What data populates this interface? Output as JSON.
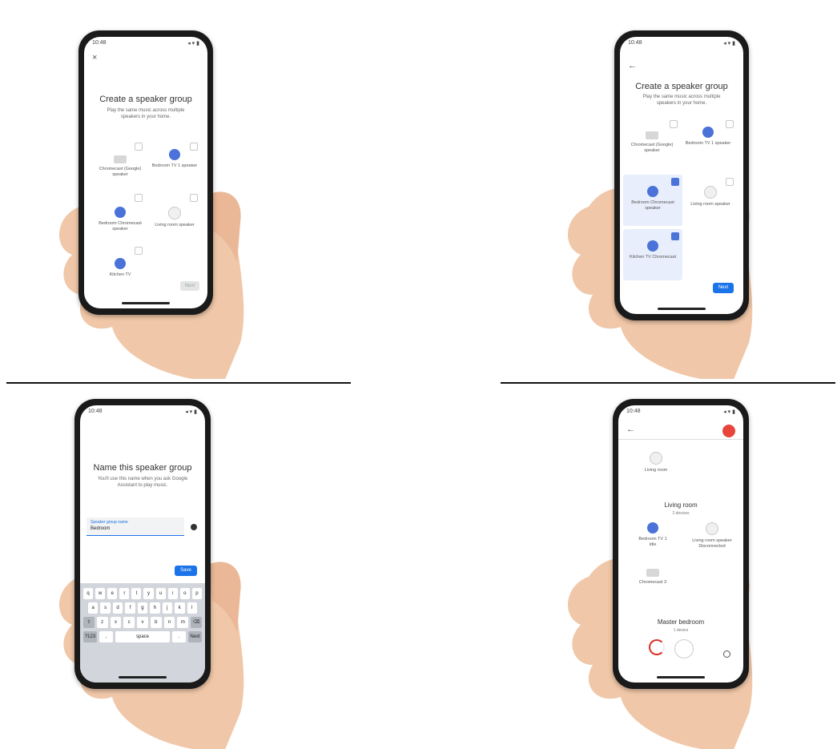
{
  "status_time": "10:48",
  "status_icons": "◂ ▾ ▮",
  "panel1": {
    "back": "×",
    "title": "Create a speaker group",
    "subtitle": "Play the same music across multiple speakers in your home.",
    "devices": [
      {
        "label": "Chromecast (Google) speaker"
      },
      {
        "label": "Bedroom TV 1 speaker"
      },
      {
        "label": "Bedroom Chromecast speaker"
      },
      {
        "label": "Living room speaker"
      },
      {
        "label": "Kitchen TV"
      }
    ],
    "next_button": "Next"
  },
  "panel2": {
    "back": "←",
    "title": "Create a speaker group",
    "subtitle": "Play the same music across multiple speakers in your home.",
    "devices": [
      {
        "label": "Chromecast (Google) speaker"
      },
      {
        "label": "Bedroom TV 1 speaker"
      },
      {
        "label": "Bedroom Chromecast speaker"
      },
      {
        "label": "Living room speaker"
      },
      {
        "label": "Kitchen TV Chromecast"
      }
    ],
    "next_button": "Next"
  },
  "panel3": {
    "title": "Name this speaker group",
    "subtitle": "You'll use this name when you ask Google Assistant to play music.",
    "field_label": "Speaker group name",
    "field_value": "Bedroom",
    "save_button": "Save",
    "keys_row1": [
      "q",
      "w",
      "e",
      "r",
      "t",
      "y",
      "u",
      "i",
      "o",
      "p"
    ],
    "keys_row2": [
      "a",
      "s",
      "d",
      "f",
      "g",
      "h",
      "j",
      "k",
      "l"
    ],
    "keys_row3": [
      "⇧",
      "z",
      "x",
      "c",
      "v",
      "b",
      "n",
      "m",
      "⌫"
    ],
    "keys_row4": [
      "?123",
      ",",
      "space",
      ".",
      "Next"
    ]
  },
  "panel4": {
    "back": "←",
    "top_item": "Living room",
    "section1": "Living room",
    "section1_sub": "2 devices",
    "dev1": "Bedroom TV 1",
    "dev1_sub": "Idle",
    "dev2": "Living room speaker",
    "dev2_sub": "Disconnected",
    "dev3": "Chromecast 3",
    "section2": "Master bedroom",
    "section2_sub": "1 device"
  }
}
